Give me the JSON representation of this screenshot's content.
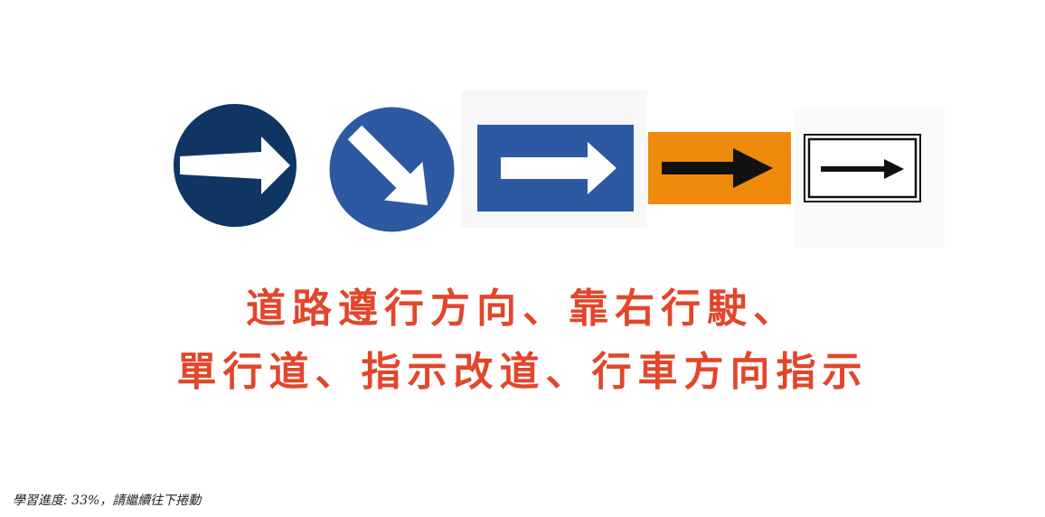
{
  "colors": {
    "dark_navy": "#0f3563",
    "sign_blue": "#2c59a2",
    "orange": "#f08a0b",
    "headline_red": "#e2462b"
  },
  "signs": [
    {
      "icon": "keep-right-arrow-icon"
    },
    {
      "icon": "keep-right-diagonal-arrow-icon"
    },
    {
      "icon": "one-way-arrow-icon"
    },
    {
      "icon": "detour-arrow-icon"
    },
    {
      "icon": "direction-arrow-icon"
    }
  ],
  "headline": {
    "line1": "道路遵行方向、靠右行駛、",
    "line2": "單行道、指示改道、行車方向指示"
  },
  "footer": {
    "progress_text": "學習進度: 33%，請繼續往下捲動"
  }
}
